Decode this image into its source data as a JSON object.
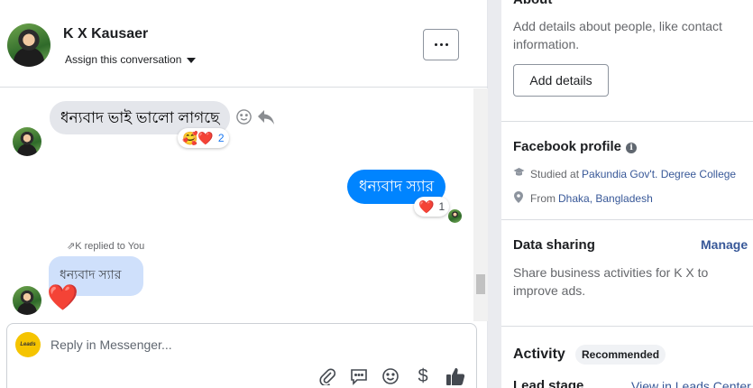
{
  "conversation": {
    "contact_name": "K X Kausaer",
    "assign_label": "Assign this conversation",
    "messages": [
      {
        "direction": "incoming",
        "text": "ধন্যবাদ ভাই ভালো লাগছে",
        "reactions": "🥰❤️",
        "reaction_count": "2"
      },
      {
        "direction": "outgoing",
        "text": "ধন্যবাদ স্যার",
        "reactions": "❤️",
        "reaction_count": "1"
      }
    ],
    "reply_notice": "K replied to You",
    "quoted_text": "ধন্যবাদ স্যার",
    "latest_message": "❤️",
    "composer": {
      "placeholder": "Reply in Messenger...",
      "page_logo_text": "Leads"
    }
  },
  "info_panel": {
    "about": {
      "title": "About",
      "description": "Add details about people, like contact information.",
      "add_button": "Add details"
    },
    "facebook_profile": {
      "title": "Facebook profile",
      "studied_prefix": "Studied at",
      "school": "Pakundia Gov't. Degree College",
      "from_prefix": "From",
      "location": "Dhaka, Bangladesh"
    },
    "data_sharing": {
      "title": "Data sharing",
      "manage_label": "Manage",
      "description": "Share business activities for K X to improve ads."
    },
    "activity": {
      "title": "Activity",
      "badge": "Recommended",
      "lead_stage_label": "Lead stage",
      "leads_link": "View in Leads Center"
    }
  },
  "colors": {
    "outgoing_bubble": "#0084ff",
    "incoming_bubble": "#e4e6eb",
    "quoted_bubble": "#cfe0fb",
    "link": "#385898"
  }
}
